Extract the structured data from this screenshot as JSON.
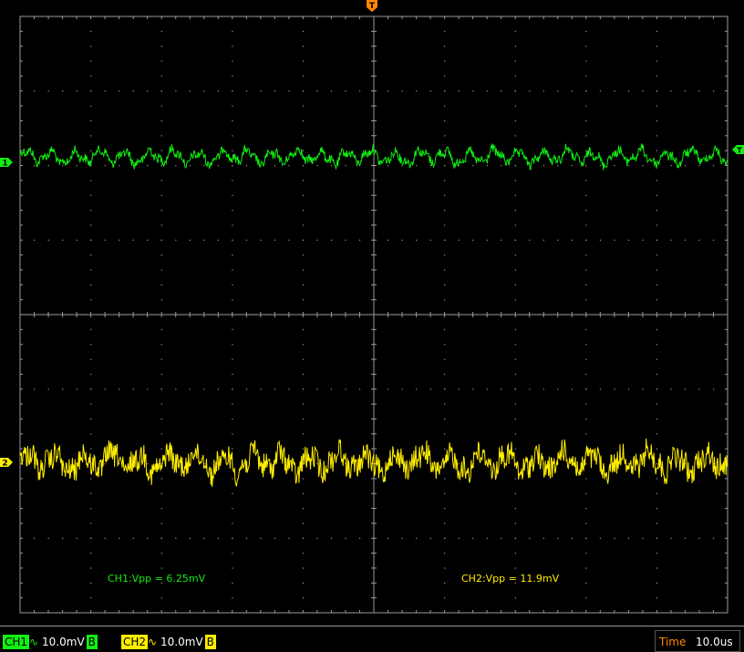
{
  "colors": {
    "ch1": "#11ee11",
    "ch2": "#ffee00",
    "grid": "#9a9a9a",
    "time": "#ff8800",
    "background": "#000000"
  },
  "markers": {
    "trigger_top": "T",
    "trigger_right": "T",
    "ch1_marker": "1",
    "ch2_marker": "2"
  },
  "measurements": {
    "ch1": "CH1:Vpp = 6.25mV",
    "ch2": "CH2:Vpp = 11.9mV"
  },
  "status": {
    "ch1_label": "CH1",
    "ch1_coupling": "∿",
    "ch1_scale": "10.0mV",
    "ch1_bw": "B",
    "ch2_label": "CH2",
    "ch2_coupling": "∿",
    "ch2_scale": "10.0mV",
    "ch2_bw": "B",
    "time_label": "Time",
    "time_value": "10.0us"
  },
  "icons": {
    "trigger": "trigger-marker-icon",
    "coupling": "ac-coupling-icon"
  }
}
